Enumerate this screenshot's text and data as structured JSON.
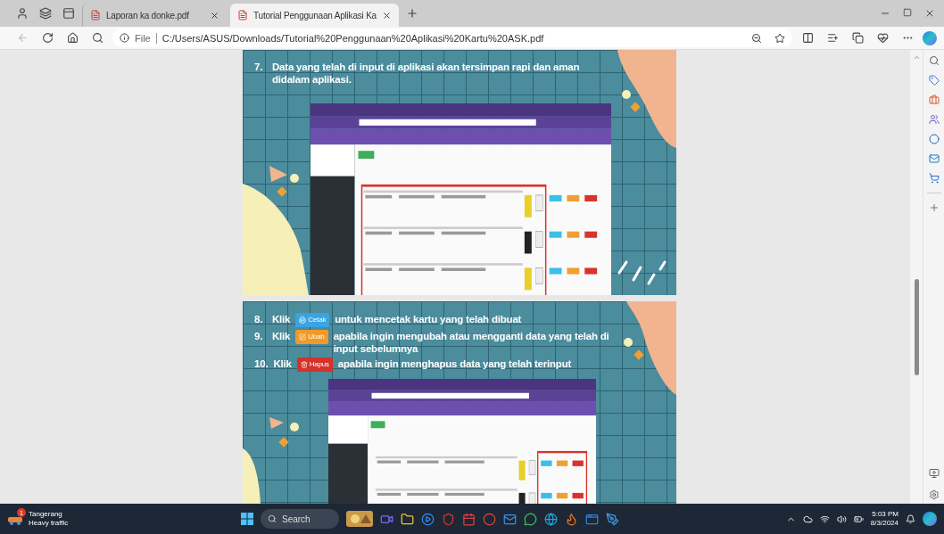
{
  "tabs": [
    {
      "title": "Laporan ka donke.pdf",
      "selected": false
    },
    {
      "title": "Tutorial Penggunaan Aplikasi Ka",
      "selected": true
    }
  ],
  "address_bar": {
    "scheme": "File",
    "url": "C:/Users/ASUS/Downloads/Tutorial%20Penggunaan%20Aplikasi%20Kartu%20ASK.pdf"
  },
  "slides": [
    {
      "steps": [
        {
          "number": "7.",
          "text": "Data yang telah di input di aplikasi akan tersimpan rapi dan aman didalam aplikasi."
        }
      ]
    },
    {
      "steps": [
        {
          "number": "8.",
          "action": "Klik",
          "button": {
            "kind": "print",
            "label": "Cetak"
          },
          "text": "untuk mencetak kartu yang telah dibuat"
        },
        {
          "number": "9.",
          "action": "Klik",
          "button": {
            "kind": "edit",
            "label": "Ubah"
          },
          "text": "apabila ingin mengubah atau mengganti data yang telah di input sebelumnya"
        },
        {
          "number": "10.",
          "action": "Klik",
          "button": {
            "kind": "delete",
            "label": "Hapus"
          },
          "text": "apabila ingin menghapus data yang telah terinput"
        }
      ]
    }
  ],
  "taskbar": {
    "weather": {
      "location": "Tangerang",
      "condition": "Heavy traffic",
      "badge": "1"
    },
    "search": {
      "placeholder": "Search"
    },
    "clock": {
      "time": "5:03 PM",
      "date": "8/3/2024"
    }
  }
}
